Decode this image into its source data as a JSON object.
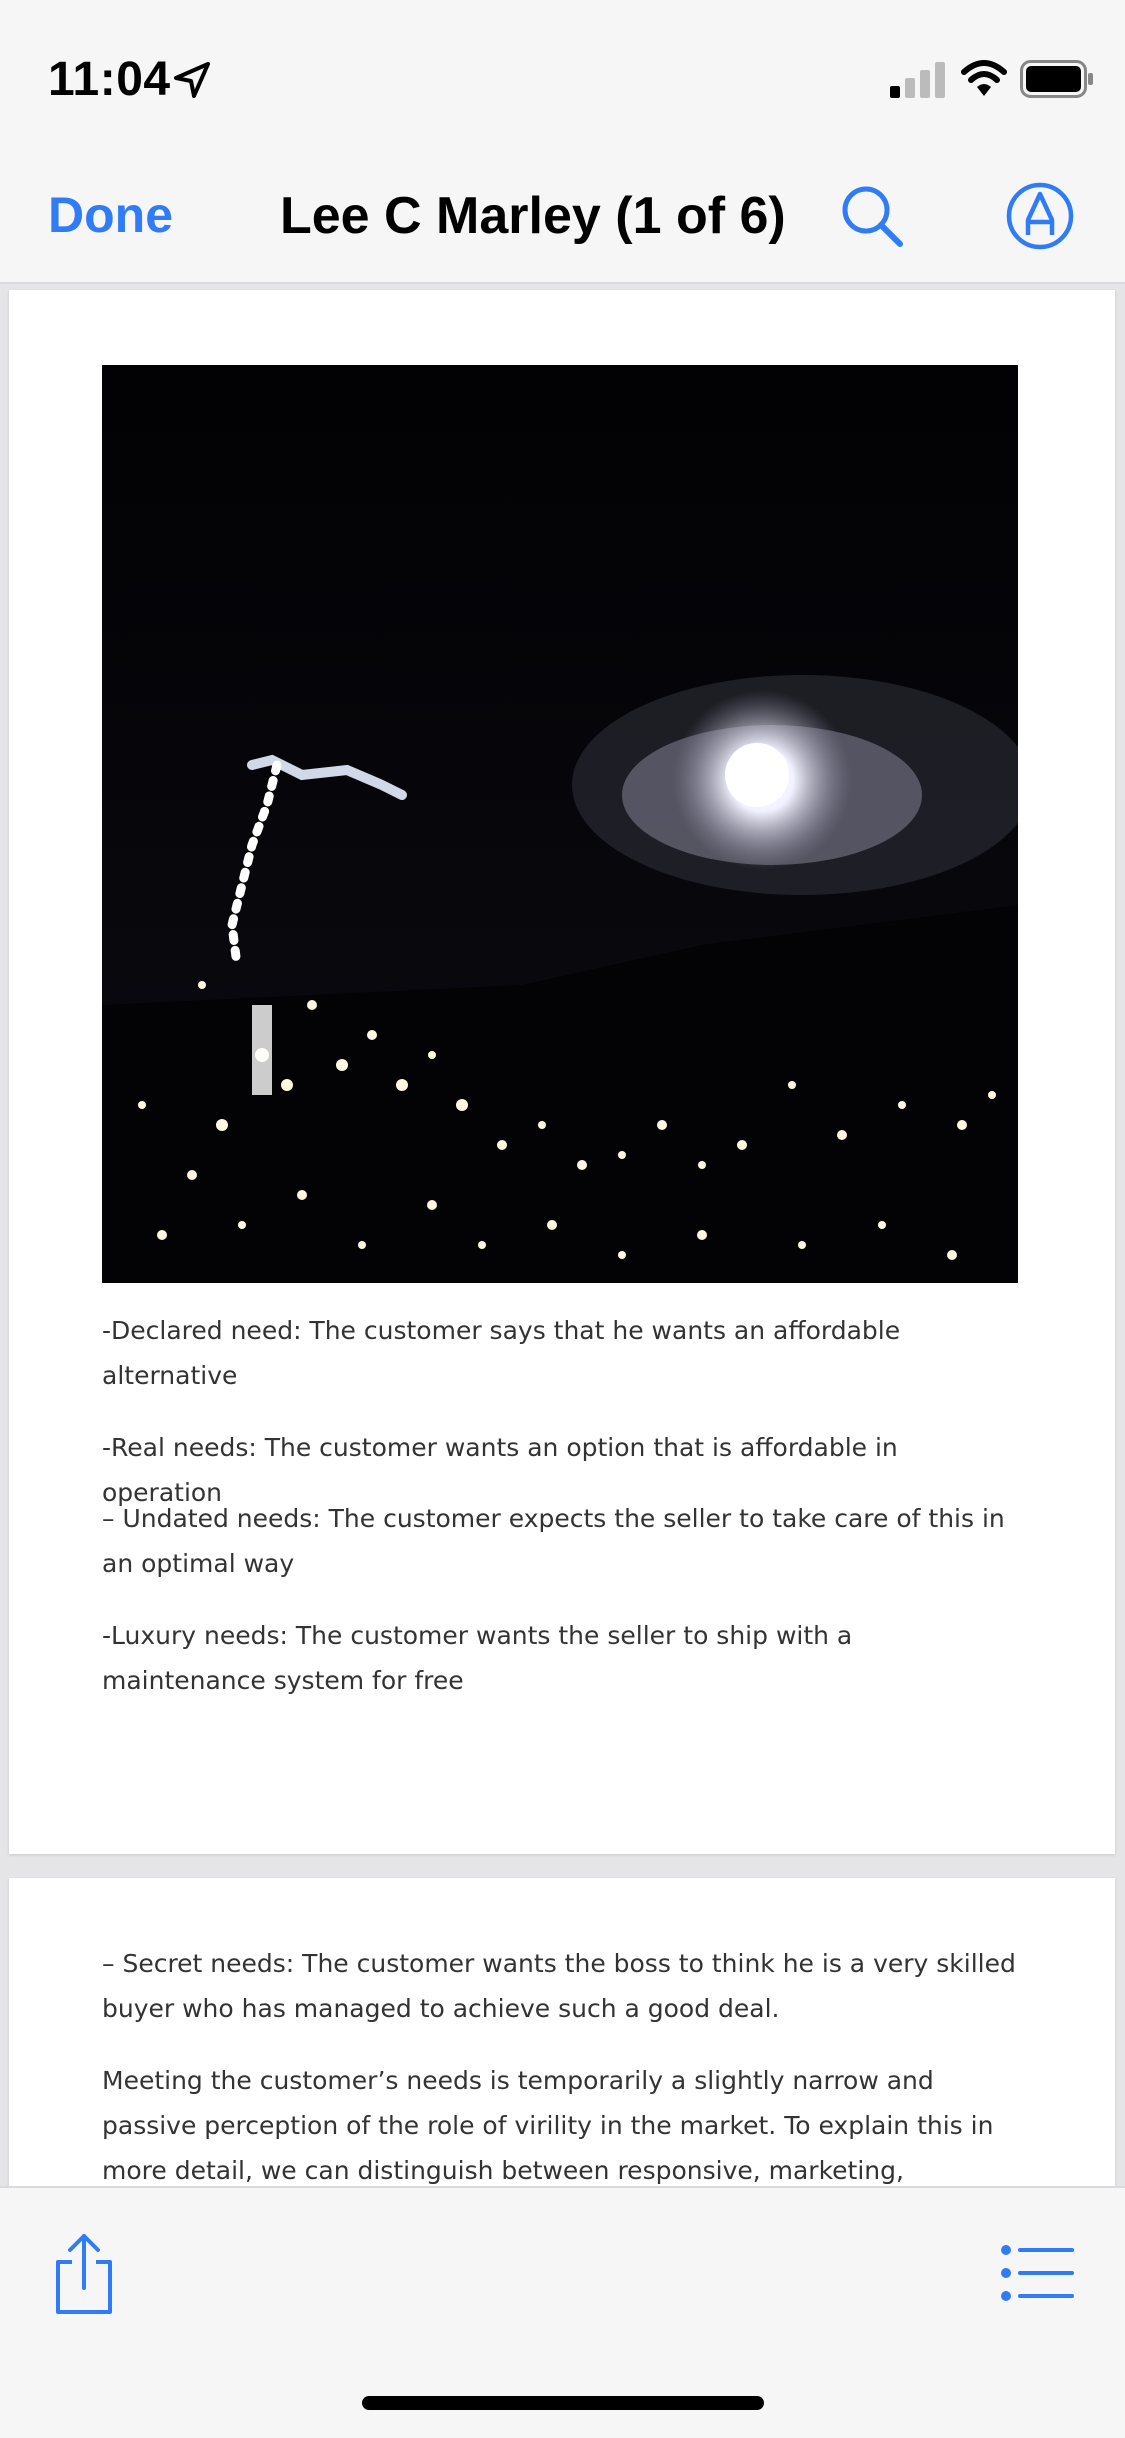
{
  "status_bar": {
    "time": "11:04",
    "icons": [
      "location-arrow-icon",
      "cellular-signal-icon",
      "wifi-icon",
      "battery-icon"
    ]
  },
  "nav": {
    "done_label": "Done",
    "title": "Lee C Marley  (1 of 6)",
    "accent_color": "#2f7cf6",
    "icons": [
      "search-icon",
      "markup-pen-icon"
    ]
  },
  "document": {
    "page1": {
      "photo_description_icon": "night-moon-photo",
      "paragraphs": [
        "-Declared need: The customer says that he wants an affordable alternative",
        "-Real needs: The customer wants an option that is affordable in operation",
        "– Undated needs: The customer expects the seller to take care of this in an optimal way",
        "-Luxury needs: The customer wants the seller to ship with a maintenance system for free"
      ]
    },
    "page2": {
      "paragraphs": [
        "– Secret needs: The customer wants the boss to think he is a very skilled buyer who has managed to achieve such a good deal.",
        "Meeting the customer’s needs is temporarily a slightly narrow and passive perception of the role of virility in the market. To explain this in more detail, we can distinguish between responsive, marketing, predictive"
      ]
    }
  },
  "toolbar": {
    "icons": [
      "share-icon",
      "list-icon"
    ]
  }
}
